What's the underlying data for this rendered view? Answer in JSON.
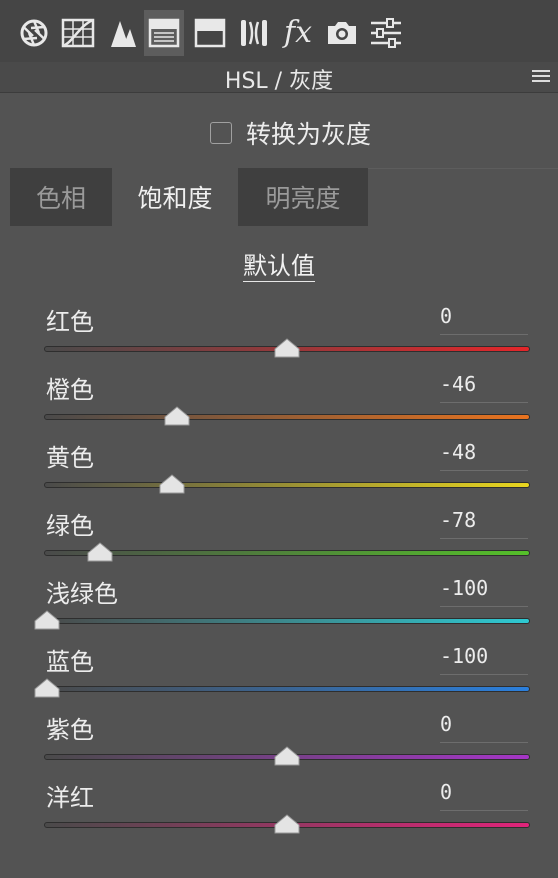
{
  "toolbar": {
    "icons": [
      "aperture-icon",
      "tone-curve-icon",
      "detail-icon",
      "hsl-icon",
      "split-toning-icon",
      "lens-icon",
      "fx-icon",
      "camera-icon",
      "presets-icon"
    ],
    "fx_label": "fx"
  },
  "header": {
    "title": "HSL / 灰度"
  },
  "grayscale": {
    "label": "转换为灰度",
    "checked": false
  },
  "tabs": [
    {
      "label": "色相",
      "active": false
    },
    {
      "label": "饱和度",
      "active": true
    },
    {
      "label": "明亮度",
      "active": false
    }
  ],
  "default_label": "默认值",
  "sliders": [
    {
      "label": "红色",
      "value": "0"
    },
    {
      "label": "橙色",
      "value": "-46"
    },
    {
      "label": "黄色",
      "value": "-48"
    },
    {
      "label": "绿色",
      "value": "-78"
    },
    {
      "label": "浅绿色",
      "value": "-100"
    },
    {
      "label": "蓝色",
      "value": "-100"
    },
    {
      "label": "紫色",
      "value": "0"
    },
    {
      "label": "洋红",
      "value": "0"
    }
  ],
  "colors": {
    "red": "#e3262a",
    "orange": "#e8731f",
    "yellow": "#e8d51f",
    "green": "#55c02a",
    "aqua": "#2ec9d2",
    "blue": "#2b7fdc",
    "purple": "#a536c6",
    "magenta": "#e0247a"
  }
}
